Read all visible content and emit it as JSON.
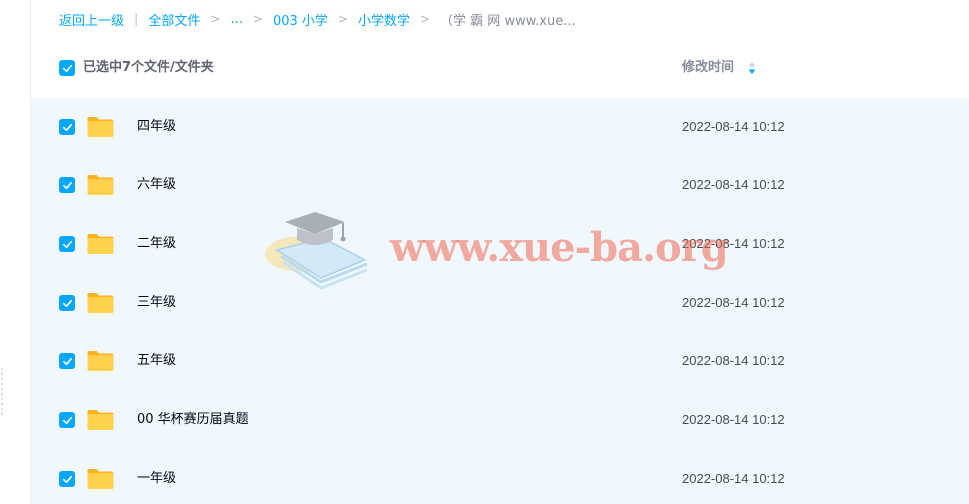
{
  "breadcrumb": {
    "back": "返回上一级",
    "separator": "|",
    "all_files": "全部文件",
    "ellipsis": "...",
    "path": [
      "003 小学",
      "小学数学"
    ],
    "current": "（学 霸 网 www.xue..."
  },
  "header": {
    "selection_label": "已选中7个文件/文件夹",
    "time_column": "修改时间",
    "sort_icon": "sort-arrows-icon"
  },
  "rows": [
    {
      "name": "四年级",
      "time": "2022-08-14 10:12",
      "checked": true
    },
    {
      "name": "六年级",
      "time": "2022-08-14 10:12",
      "checked": true
    },
    {
      "name": "二年级",
      "time": "2022-08-14 10:12",
      "checked": true
    },
    {
      "name": "三年级",
      "time": "2022-08-14 10:12",
      "checked": true
    },
    {
      "name": "五年级",
      "time": "2022-08-14 10:12",
      "checked": true
    },
    {
      "name": "00 华杯赛历届真题",
      "time": "2022-08-14 10:12",
      "checked": true
    },
    {
      "name": "一年级",
      "time": "2022-08-14 10:12",
      "checked": true
    }
  ],
  "watermark": {
    "text": "www.xue-ba.org"
  },
  "colors": {
    "accent": "#06a7ff",
    "row_background": "#f1f8fd",
    "folder": "#ffc533"
  }
}
